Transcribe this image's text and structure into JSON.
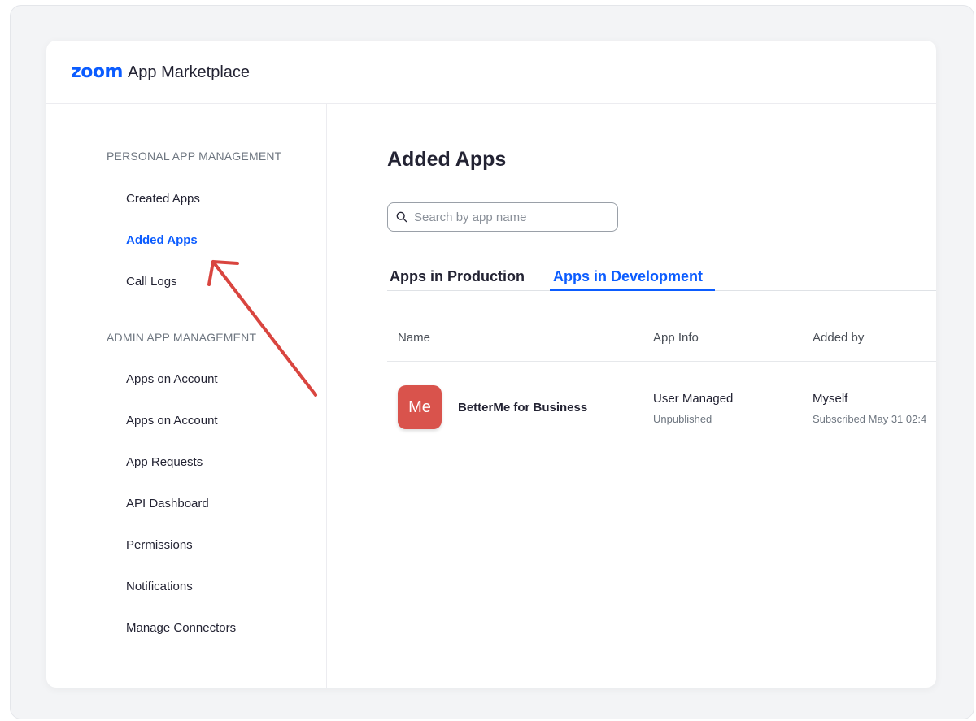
{
  "header": {
    "logo_brand": "zoom",
    "logo_text": "App Marketplace"
  },
  "sidebar": {
    "personal_title": "PERSONAL APP MANAGEMENT",
    "personal_items": [
      "Created Apps",
      "Added Apps",
      "Call Logs"
    ],
    "active_item": "Added Apps",
    "admin_title": "ADMIN APP MANAGEMENT",
    "admin_items": [
      "Apps on Account",
      "Apps on Account",
      "App Requests",
      "API Dashboard",
      "Permissions",
      "Notifications",
      "Manage Connectors"
    ]
  },
  "main": {
    "title": "Added Apps",
    "search": {
      "placeholder": "Search by app name",
      "value": ""
    },
    "tabs": [
      {
        "label": "Apps in Production",
        "active": false
      },
      {
        "label": "Apps in Development",
        "active": true
      }
    ],
    "table": {
      "columns": [
        "Name",
        "App Info",
        "Added by"
      ],
      "rows": [
        {
          "icon_text": "Me",
          "name": "BetterMe for Business",
          "app_info": "User Managed",
          "app_status": "Unpublished",
          "added_by": "Myself",
          "subscribed": "Subscribed May 31 02:4"
        }
      ]
    }
  },
  "colors": {
    "accent": "#0b5cff",
    "annotation_arrow": "#d9453f",
    "app_icon": "#d9534c"
  }
}
